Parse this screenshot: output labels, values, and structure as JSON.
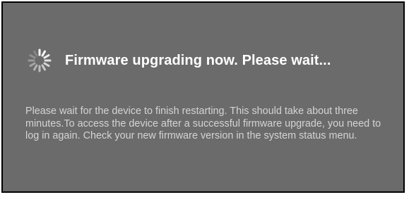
{
  "dialog": {
    "spinner_icon": "loading-spinner-icon",
    "title": "Firmware upgrading now. Please wait...",
    "message": "Please wait for the device to finish restarting. This should take about three minutes.To access the device after a successful firmware upgrade, you need to log in again. Check your new firmware version in the system status menu.",
    "colors": {
      "background": "#6b6b6b",
      "border": "#000000",
      "title": "#ffffff",
      "message": "#d4d4d4"
    }
  }
}
